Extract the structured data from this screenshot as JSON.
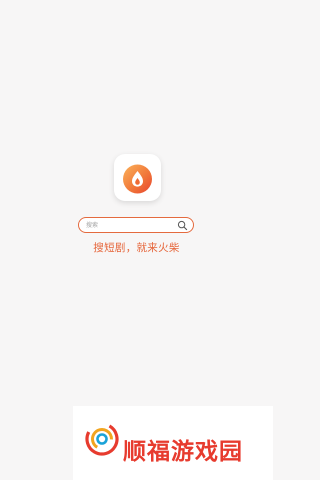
{
  "app": {
    "icon": "flame-app-icon",
    "accent_color": "#e46a3e"
  },
  "search": {
    "placeholder": "搜索",
    "icon": "search-icon"
  },
  "slogan": "搜短剧，就来火柴",
  "watermark": {
    "text": "顺福游戏园",
    "color": "#e73b2e"
  }
}
